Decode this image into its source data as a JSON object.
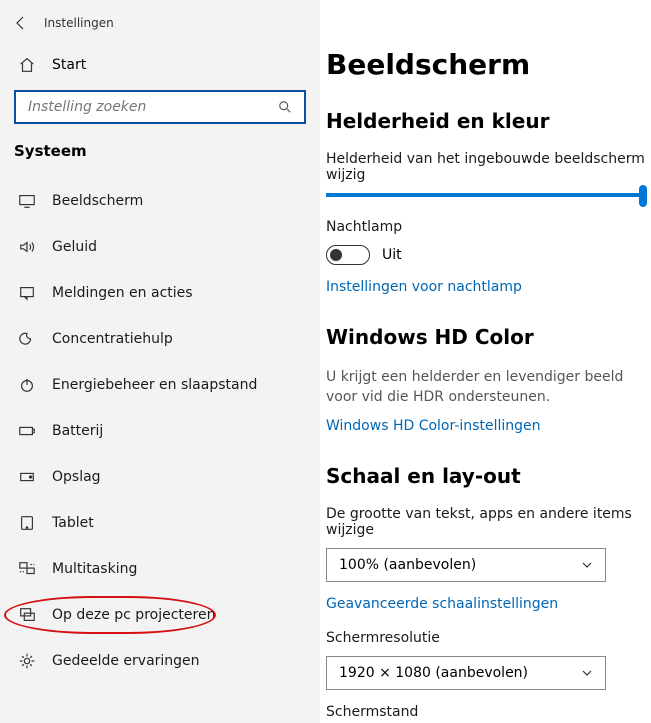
{
  "window": {
    "title": "Instellingen"
  },
  "sidebar": {
    "home": "Start",
    "search_placeholder": "Instelling zoeken",
    "section": "Systeem",
    "items": [
      {
        "label": "Beeldscherm"
      },
      {
        "label": "Geluid"
      },
      {
        "label": "Meldingen en acties"
      },
      {
        "label": "Concentratiehulp"
      },
      {
        "label": "Energiebeheer en slaapstand"
      },
      {
        "label": "Batterij"
      },
      {
        "label": "Opslag"
      },
      {
        "label": "Tablet"
      },
      {
        "label": "Multitasking"
      },
      {
        "label": "Op deze pc projecteren"
      },
      {
        "label": "Gedeelde ervaringen"
      }
    ]
  },
  "main": {
    "title": "Beeldscherm",
    "brightness": {
      "heading": "Helderheid en kleur",
      "label": "Helderheid van het ingebouwde beeldscherm wijzig",
      "nightlight_label": "Nachtlamp",
      "nightlight_state": "Uit",
      "nightlight_link": "Instellingen voor nachtlamp"
    },
    "hdcolor": {
      "heading": "Windows HD Color",
      "desc": "U krijgt een helderder en levendiger beeld voor vid die HDR ondersteunen.",
      "link": "Windows HD Color-instellingen"
    },
    "scale": {
      "heading": "Schaal en lay-out",
      "textsize_label": "De grootte van tekst, apps en andere items wijzige",
      "textsize_value": "100% (aanbevolen)",
      "advanced_link": "Geavanceerde schaalinstellingen",
      "res_label": "Schermresolutie",
      "res_value": "1920 × 1080 (aanbevolen)",
      "orient_label": "Schermstand"
    }
  }
}
